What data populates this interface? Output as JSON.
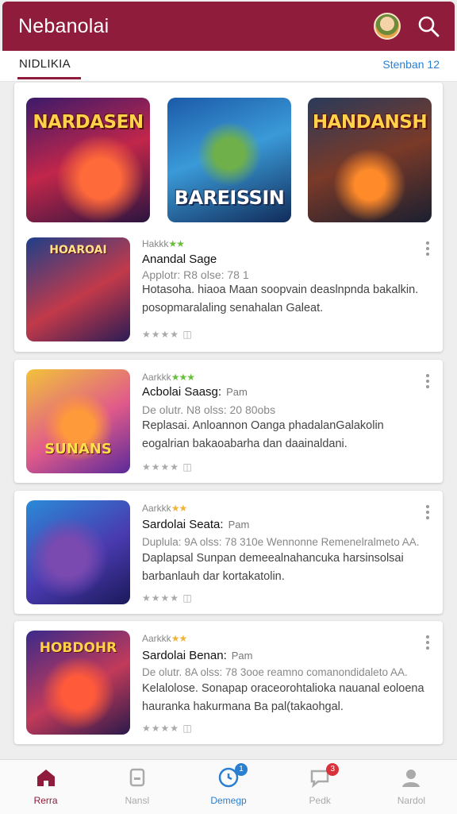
{
  "header": {
    "title": "Nebanolai",
    "avatar_icon": "avatar-icon",
    "search_icon": "search-icon"
  },
  "tabs": {
    "active": "NIDLIKIA",
    "right_link": "Stenban 12"
  },
  "featured": [
    {
      "label": "NARDASEN"
    },
    {
      "label": "BAREISSIN"
    },
    {
      "label": "HANDANSH"
    }
  ],
  "items": [
    {
      "thumb_label": "HOAROAI",
      "rating": "Hakkk",
      "title": "Anandal Sage",
      "title_suffix": "",
      "meta": "Applotr: R8 olse: 78 1",
      "desc_1": "Hotasoha. hiaoa Maan soopvain deaslnpnda bakalkin.",
      "desc_2": "posopmaralaling senahalan Galeat.",
      "foot": "★★★★ ◫"
    },
    {
      "thumb_label": "SUNANS",
      "rating": "Aarkkk",
      "title": "Acbolai Saasg:",
      "title_suffix": "Pam",
      "meta": "De olutr. N8 olss: 20 80obs",
      "desc_1": "Replasai. Anloannon Oanga phadalanGalakolin",
      "desc_2": "eogalrian bakaoabarha dan daainaldani.",
      "foot": "★★★★ ◫"
    },
    {
      "thumb_label": "",
      "rating": "Aarkkk",
      "title": "Sardolai Seata:",
      "title_suffix": "Pam",
      "meta": "Duplula: 9A olss: 78 310e Wennonne Remenelralmeto AA.",
      "desc_1": "Daplapsal Sunpan demeealnahancuka harsinsolsai",
      "desc_2": "barbanlauh dar kortakatolin.",
      "foot": "★★★★ ◫"
    },
    {
      "thumb_label": "HOBDOHR",
      "rating": "Aarkkk",
      "title": "Sardolai Benan:",
      "title_suffix": "Pam",
      "meta": "De olutr. 8A olss: 78 3ooe reamno comanondidaleto AA.",
      "desc_1": "Kelalolose. Sonapap oraceorohtalioka nauanal eoloena",
      "desc_2": "hauranka hakurmana Ba pal(takaohgal.",
      "foot": "★★★★ ◫"
    }
  ],
  "nav": [
    {
      "label": "Rerra",
      "icon": "home-icon"
    },
    {
      "label": "Nansl",
      "icon": "library-icon"
    },
    {
      "label": "Demegp",
      "icon": "games-icon",
      "badge": "1"
    },
    {
      "label": "Pedk",
      "icon": "chat-icon",
      "badge": "3"
    },
    {
      "label": "Nardol",
      "icon": "profile-icon"
    }
  ],
  "colors": {
    "brand": "#8e1c3a",
    "link": "#2a7fd0",
    "star": "#6abf3a"
  }
}
